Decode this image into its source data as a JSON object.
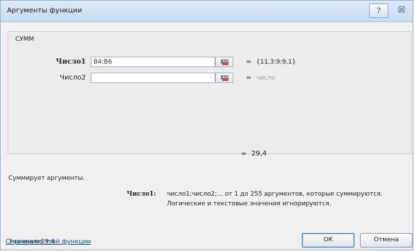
{
  "window": {
    "title": "Аргументы функции",
    "help_glyph": "?",
    "close_glyph": "☒"
  },
  "function": {
    "name": "СУММ",
    "args": [
      {
        "label": "Число1",
        "value": "B4:B6",
        "placeholder": "",
        "equals": "=",
        "result": "{11,3:9:9,1}",
        "bold": true
      },
      {
        "label": "Число2",
        "value": "",
        "placeholder": "",
        "equals": "=",
        "result": "число",
        "bold": false
      }
    ],
    "total_equals": "=",
    "total_value": "29,4"
  },
  "description": {
    "summary": "Суммирует аргументы.",
    "arg_label": "Число1:",
    "arg_text_line1": "число1;число2;... от 1 до 255 аргументов, которые суммируются.",
    "arg_text_line2": "Логические и текстовые значения игнорируются."
  },
  "footer": {
    "value_label": "Значение:",
    "value": "29,4",
    "help_link": "Справка по этой функции",
    "ok_label": "ОК",
    "cancel_label": "Отмена"
  },
  "icons": {
    "collapse_dialog": "range-select-icon",
    "help": "help-icon",
    "close": "close-icon"
  },
  "colors": {
    "link": "#0b4fa8",
    "titlebar": "#c9dcf0",
    "muted_result": "#9ca2a8"
  }
}
